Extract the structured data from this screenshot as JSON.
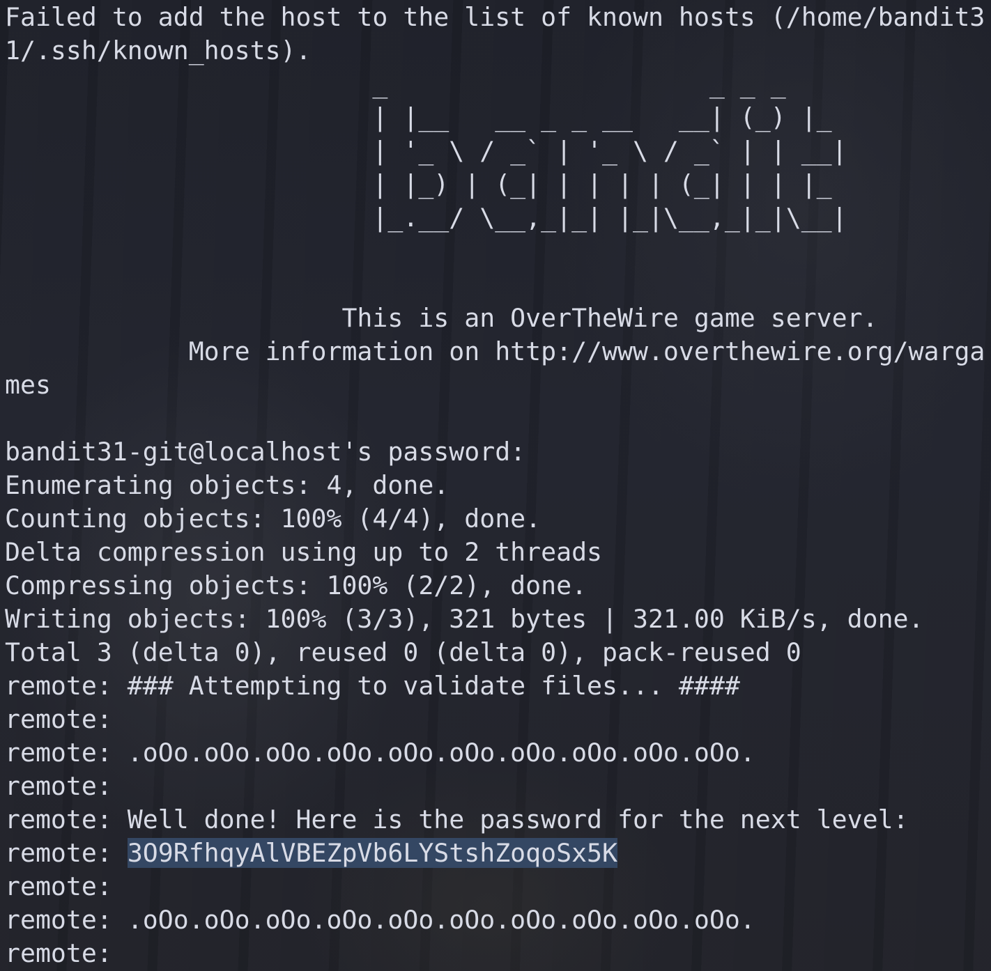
{
  "terminal": {
    "lines": [
      "Failed to add the host to the list of known hosts (/home/bandit3",
      "1/.ssh/known_hosts).",
      "                        _                     _ _ _",
      "                        | |__   __ _ _ __   __| (_) |_",
      "                        | '_ \\ / _` | '_ \\ / _` | | __|",
      "                        | |_) | (_| | | | | (_| | | |_",
      "                        |_.__/ \\__,_|_| |_|\\__,_|_|\\__|",
      "",
      "",
      "                      This is an OverTheWire game server.",
      "            More information on http://www.overthewire.org/warga",
      "mes",
      "",
      "bandit31-git@localhost's password:",
      "Enumerating objects: 4, done.",
      "Counting objects: 100% (4/4), done.",
      "Delta compression using up to 2 threads",
      "Compressing objects: 100% (2/2), done.",
      "Writing objects: 100% (3/3), 321 bytes | 321.00 KiB/s, done.",
      "Total 3 (delta 0), reused 0 (delta 0), pack-reused 0",
      "remote: ### Attempting to validate files... ####",
      "remote:",
      "remote: .oOo.oOo.oOo.oOo.oOo.oOo.oOo.oOo.oOo.oOo.",
      "remote:",
      "remote: Well done! Here is the password for the next level:"
    ],
    "password_prefix": "remote: ",
    "password_value": "3O9RfhqyAlVBEZpVb6LYStshZoqoSx5K",
    "tail_lines": [
      "remote:",
      "remote: .oOo.oOo.oOo.oOo.oOo.oOo.oOo.oOo.oOo.oOo.",
      "remote:"
    ]
  }
}
